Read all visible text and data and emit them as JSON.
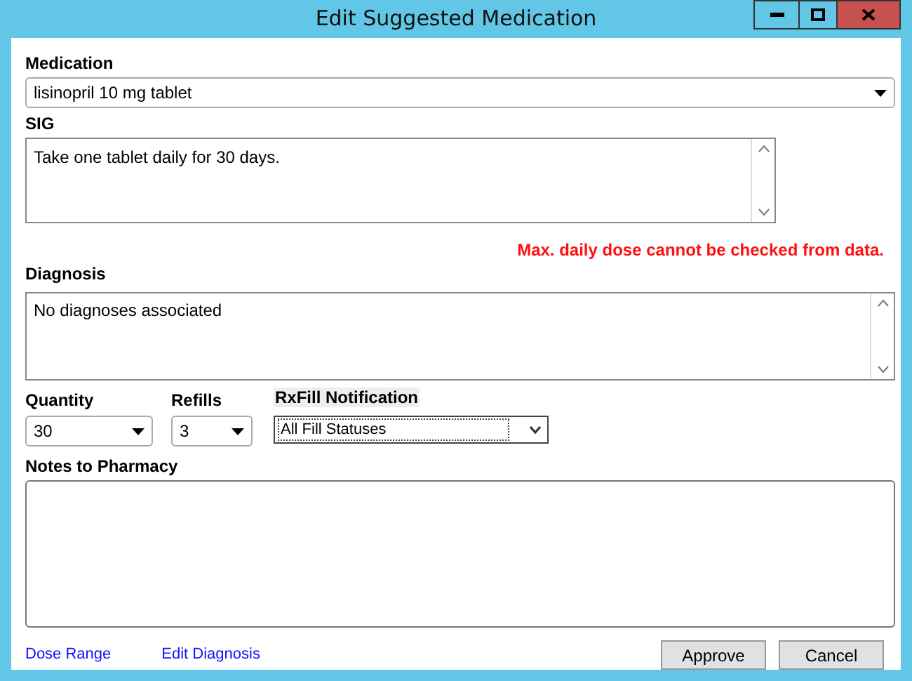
{
  "window": {
    "title": "Edit Suggested Medication"
  },
  "medication": {
    "label": "Medication",
    "value": "lisinopril 10 mg tablet"
  },
  "sig": {
    "label": "SIG",
    "value": "Take one tablet daily for 30 days."
  },
  "warning": "Max. daily dose cannot be checked from data.",
  "diagnosis": {
    "label": "Diagnosis",
    "value": "No diagnoses associated"
  },
  "quantity": {
    "label": "Quantity",
    "value": "30"
  },
  "refills": {
    "label": "Refills",
    "value": "3"
  },
  "rxfill": {
    "label": "RxFill Notification",
    "value": "All Fill Statuses"
  },
  "notes": {
    "label": "Notes to Pharmacy"
  },
  "links": [
    "Dose Range",
    "Edit Diagnosis"
  ],
  "buttons": [
    "Approve",
    "Cancel"
  ]
}
